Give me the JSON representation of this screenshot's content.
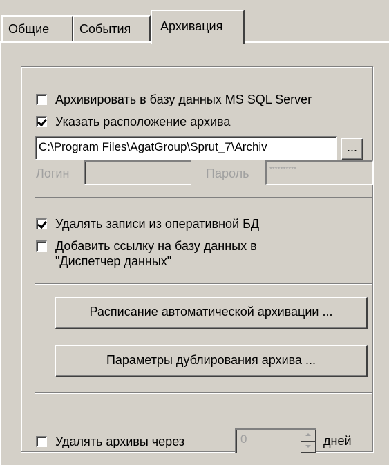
{
  "tabs": [
    {
      "label": "Общие"
    },
    {
      "label": "События"
    },
    {
      "label": "Архивация",
      "active": true
    }
  ],
  "archive": {
    "mssql_label": "Архивировать в базу данных MS SQL Server",
    "mssql_checked": false,
    "location_label": "Указать расположение архива",
    "location_checked": true,
    "path_value": "C:\\Program Files\\AgatGroup\\Sprut_7\\Archiv",
    "browse_label": "...",
    "login_label": "Логин",
    "login_value": "",
    "password_label": "Пароль",
    "password_value": "**********",
    "delete_records_label": "Удалять записи из  оперативной БД",
    "delete_records_checked": true,
    "add_link_label_line1": "Добавить ссылку на базу данных в",
    "add_link_label_line2": "\"Диспетчер данных\"",
    "add_link_checked": false,
    "schedule_button": "Расписание автоматической архивации ...",
    "duplicate_button": "Параметры дублирования архива ...",
    "delete_archives_label": "Удалять архивы через",
    "delete_archives_checked": false,
    "days_value": "0",
    "days_label": "дней"
  },
  "colors": {
    "face": "#d4d0c8",
    "disabled_text": "#a0a0a0"
  }
}
